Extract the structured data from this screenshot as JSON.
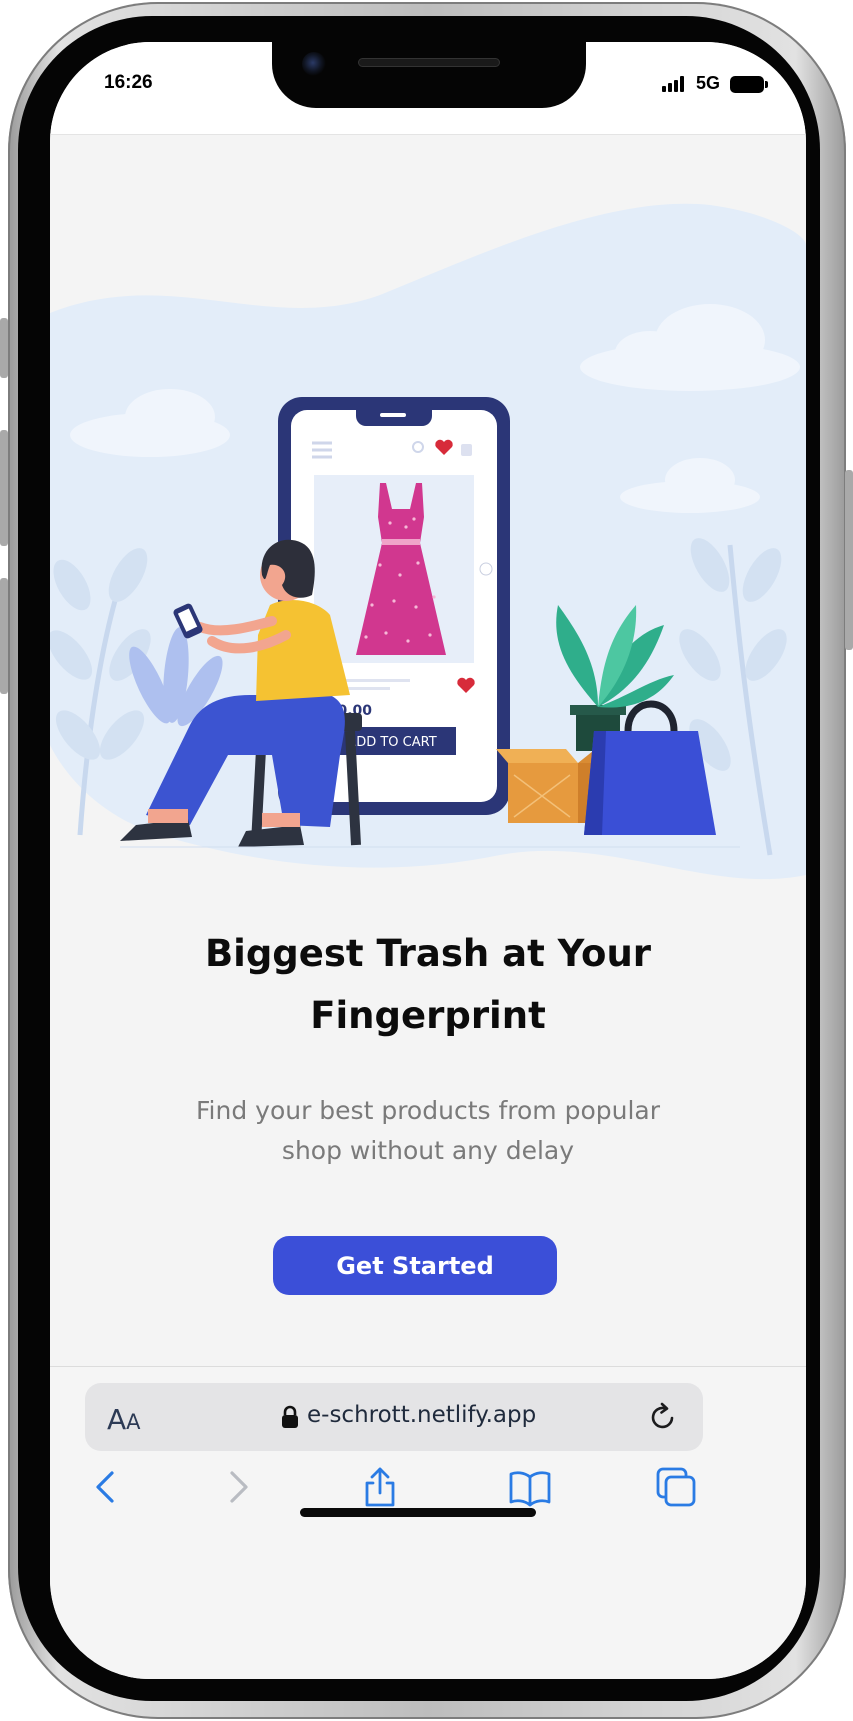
{
  "status_bar": {
    "time": "16:26",
    "network": "5G"
  },
  "hero": {
    "illustration": "woman-shopping-on-phone-illustration",
    "product_price": "$20.00",
    "add_to_cart_label": "ADD TO CART",
    "colors": {
      "navy": "#2b3677",
      "dress": "#d1378f",
      "shirt": "#f5c232",
      "pants": "#3c54d1",
      "bag": "#3a4fd6",
      "box": "#e69a3e",
      "blob": "#e3edf9"
    }
  },
  "onboarding": {
    "headline_line1": "Biggest Trash at Your",
    "headline_line2": "Fingerprint",
    "subtitle_line1": "Find your best products from popular",
    "subtitle_line2": "shop without any delay",
    "cta_label": "Get Started",
    "cta_color": "#3b4fd8"
  },
  "browser": {
    "text_size_label": "A",
    "text_size_label_small": "A",
    "url": "e-schrott.netlify.app",
    "icons": {
      "text_size": "aa-icon",
      "lock": "lock-icon",
      "reload": "reload-icon",
      "back": "chevron-left-icon",
      "forward": "chevron-right-icon",
      "share": "share-icon",
      "bookmarks": "book-icon",
      "tabs": "tabs-icon"
    },
    "accent": "#2a7be4"
  }
}
